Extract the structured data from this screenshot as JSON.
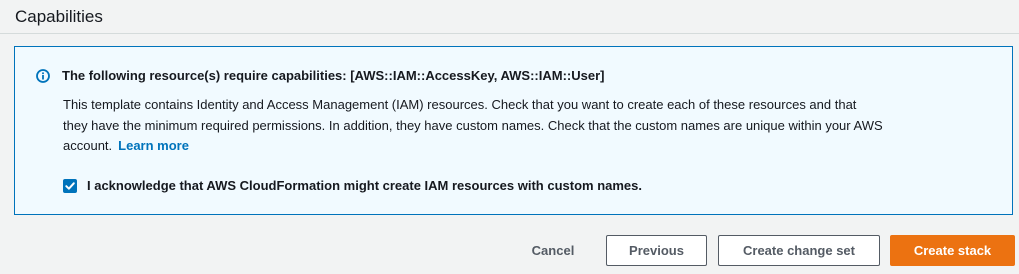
{
  "section": {
    "title": "Capabilities"
  },
  "alert": {
    "title": "The following resource(s) require capabilities: [AWS::IAM::AccessKey, AWS::IAM::User]",
    "body": "This template contains Identity and Access Management (IAM) resources. Check that you want to create each of these resources and that they have the minimum required permissions. In addition, they have custom names. Check that the custom names are unique within your AWS account.",
    "link_label": "Learn more",
    "icon": "info-icon",
    "accent_color": "#0073bb",
    "background_color": "#f1faff"
  },
  "acknowledgement": {
    "label": "I acknowledge that AWS CloudFormation might create IAM resources with custom names.",
    "checked": true
  },
  "actions": {
    "cancel_label": "Cancel",
    "previous_label": "Previous",
    "change_set_label": "Create change set",
    "create_label": "Create stack",
    "primary_color": "#ec7211"
  }
}
